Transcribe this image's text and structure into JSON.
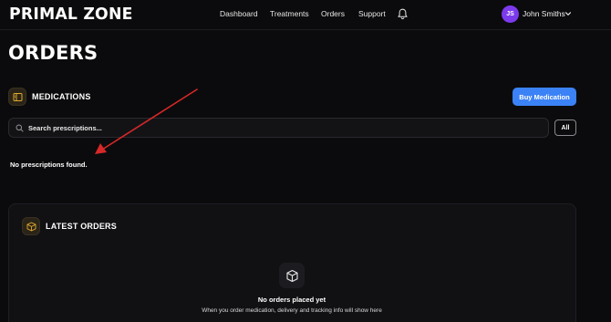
{
  "header": {
    "brand": "PRIMAL ZONE",
    "nav": [
      "Dashboard",
      "Treatments",
      "Orders",
      "Support"
    ],
    "notifications_icon": "bell-icon",
    "user": {
      "initials": "JS",
      "name": "John Smiths",
      "avatar_color": "#7c3aed"
    }
  },
  "page": {
    "title": "ORDERS"
  },
  "medications": {
    "title": "MEDICATIONS",
    "buy_label": "Buy Medication",
    "search_placeholder": "Search prescriptions...",
    "filter_label": "All",
    "empty_message": "No prescriptions found."
  },
  "latest_orders": {
    "title": "LATEST ORDERS",
    "empty_title": "No orders placed yet",
    "empty_subtitle": "When you order medication, delivery and tracking info will show here"
  },
  "colors": {
    "background": "#0b0b0d",
    "accent": "#3b82f6",
    "icon_accent": "#e0a82e",
    "annotation": "#d62828"
  }
}
